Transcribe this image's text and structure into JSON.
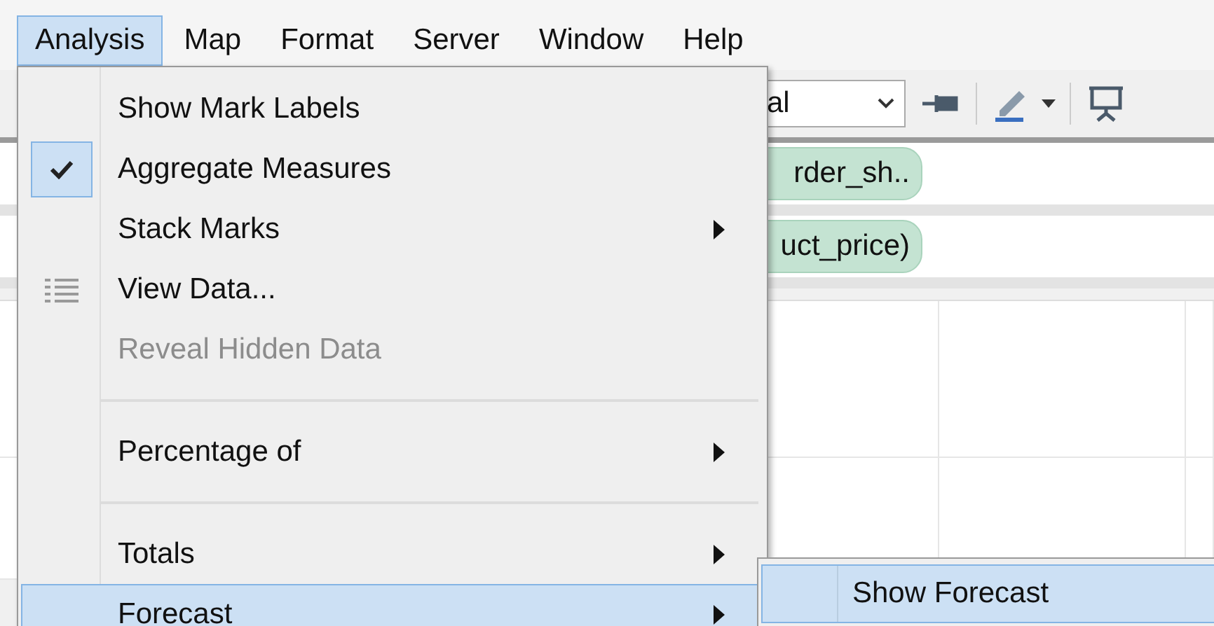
{
  "menubar": [
    {
      "label": "Analysis",
      "selected": true
    },
    {
      "label": "Map",
      "selected": false
    },
    {
      "label": "Format",
      "selected": false
    },
    {
      "label": "Server",
      "selected": false
    },
    {
      "label": "Window",
      "selected": false
    },
    {
      "label": "Help",
      "selected": false
    }
  ],
  "toolbar": {
    "dropdown_value": "al"
  },
  "shelves": [
    {
      "pill": "rder_sh.."
    },
    {
      "pill": "uct_price)"
    }
  ],
  "menu": {
    "items": [
      {
        "kind": "item",
        "label": "Show Mark Labels",
        "checked": false,
        "icon": false,
        "disabled": false,
        "submenu": false,
        "selected": false
      },
      {
        "kind": "item",
        "label": "Aggregate Measures",
        "checked": true,
        "icon": false,
        "disabled": false,
        "submenu": false,
        "selected": false
      },
      {
        "kind": "item",
        "label": "Stack Marks",
        "checked": false,
        "icon": false,
        "disabled": false,
        "submenu": true,
        "selected": false
      },
      {
        "kind": "item",
        "label": "View Data...",
        "checked": false,
        "icon": true,
        "disabled": false,
        "submenu": false,
        "selected": false
      },
      {
        "kind": "item",
        "label": "Reveal Hidden Data",
        "checked": false,
        "icon": false,
        "disabled": true,
        "submenu": false,
        "selected": false
      },
      {
        "kind": "separator"
      },
      {
        "kind": "item",
        "label": "Percentage of",
        "checked": false,
        "icon": false,
        "disabled": false,
        "submenu": true,
        "selected": false
      },
      {
        "kind": "separator"
      },
      {
        "kind": "item",
        "label": "Totals",
        "checked": false,
        "icon": false,
        "disabled": false,
        "submenu": true,
        "selected": false
      },
      {
        "kind": "item",
        "label": "Forecast",
        "checked": false,
        "icon": false,
        "disabled": false,
        "submenu": true,
        "selected": true
      }
    ]
  },
  "submenu": {
    "items": [
      {
        "label": "Show Forecast",
        "selected": true
      }
    ]
  }
}
